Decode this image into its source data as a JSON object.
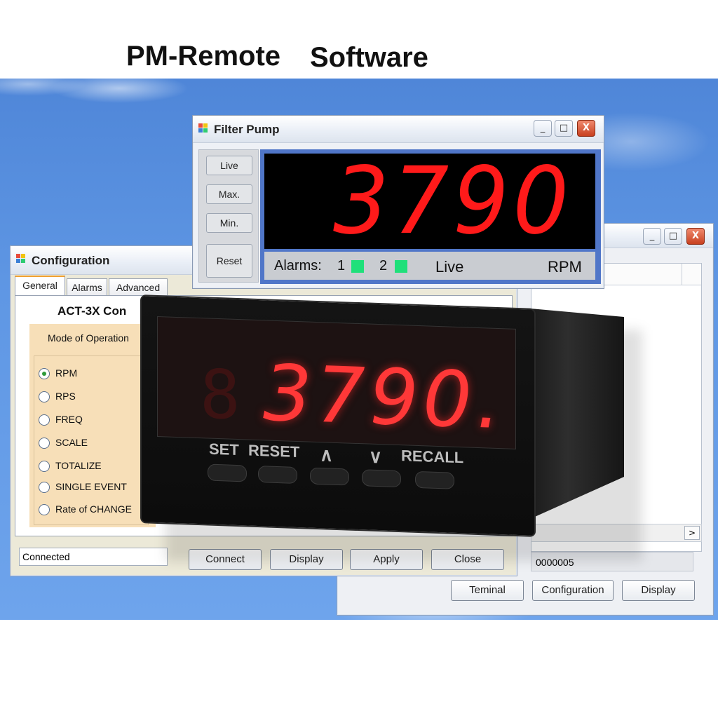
{
  "headline": {
    "part1": "PM-Remote",
    "part2": "Software"
  },
  "back_window": {
    "buttons": {
      "terminal": "Teminal",
      "configuration": "Configuration",
      "display": "Display"
    },
    "status_value": "0000005",
    "window_controls": {
      "minimize": "_",
      "maximize": "□",
      "close": "X"
    }
  },
  "config_window": {
    "title": "Configuration",
    "tabs": [
      "General",
      "Alarms",
      "Advanced"
    ],
    "device_title": "ACT-3X Con",
    "mode_label": "Mode of Operation",
    "modes": [
      "RPM",
      "RPS",
      "FREQ",
      "SCALE",
      "TOTALIZE",
      "SINGLE EVENT",
      "Rate of CHANGE"
    ],
    "selected_mode": "RPM",
    "status_text": "Connected",
    "buttons": {
      "connect": "Connect",
      "display": "Display",
      "apply": "Apply",
      "close": "Close"
    }
  },
  "pump_window": {
    "title": "Filter Pump",
    "side_buttons": {
      "live": "Live",
      "max": "Max.",
      "min": "Min.",
      "reset": "Reset"
    },
    "reading": "3790",
    "alarms_label": "Alarms:",
    "alarm1": "1",
    "alarm2": "2",
    "mode": "Live",
    "unit": "RPM",
    "window_controls": {
      "minimize": "_",
      "maximize": "□",
      "close": "X"
    },
    "colors": {
      "digits": "#ff1a1a",
      "alarm_led": "#1fe07a",
      "frame": "#5076c8"
    }
  },
  "meter": {
    "reading": "3790.",
    "keys": [
      "SET",
      "RESET",
      "^",
      "v",
      "RECALL"
    ]
  }
}
